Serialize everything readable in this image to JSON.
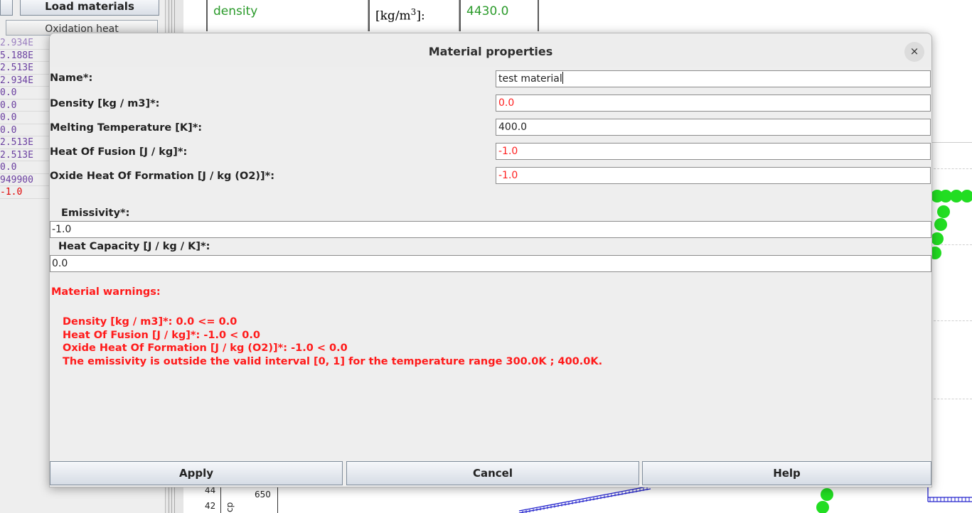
{
  "background": {
    "load_materials_label": "Load materials",
    "column_header": "Oxidation heat",
    "values": [
      {
        "text": "2.934E",
        "color": "#9b7fc0"
      },
      {
        "text": "5.188E",
        "color": "#6a3fa0"
      },
      {
        "text": "2.513E",
        "color": "#6a3fa0"
      },
      {
        "text": "2.934E",
        "color": "#6a3fa0"
      },
      {
        "text": "0.0",
        "color": "#6a3fa0"
      },
      {
        "text": "0.0",
        "color": "#6a3fa0"
      },
      {
        "text": "0.0",
        "color": "#6a3fa0"
      },
      {
        "text": "0.0",
        "color": "#6a3fa0"
      },
      {
        "text": "2.513E",
        "color": "#6a3fa0"
      },
      {
        "text": "2.513E",
        "color": "#6a3fa0"
      },
      {
        "text": "0.0",
        "color": "#6a3fa0"
      },
      {
        "text": "949900",
        "color": "#6a3fa0"
      },
      {
        "text": "-1.0",
        "color": "#e00000"
      }
    ],
    "top_table": {
      "property": "density",
      "unit_base": "[kg/m",
      "unit_sup": "3",
      "unit_end": "]:",
      "value": "4430.0"
    },
    "chart": {
      "tick_44": "44",
      "tick_42": "42",
      "tick_650": "650",
      "axis_label": "cp"
    }
  },
  "dialog": {
    "title": "Material properties",
    "close_symbol": "×",
    "fields": [
      {
        "label": "Name*:",
        "value": "test material",
        "invalid": false
      },
      {
        "label": "Density [kg / m3]*:",
        "value": "0.0",
        "invalid": true
      },
      {
        "label": "Melting Temperature [K]*:",
        "value": "400.0",
        "invalid": false
      },
      {
        "label": "Heat Of Fusion [J / kg]*:",
        "value": "-1.0",
        "invalid": true
      },
      {
        "label": "Oxide Heat Of Formation [J / kg (O2)]*:",
        "value": "-1.0",
        "invalid": true
      }
    ],
    "emissivity": {
      "label": "Emissivity*:",
      "value": "-1.0"
    },
    "heat_capacity": {
      "label": "Heat Capacity [J / kg / K]*:",
      "value": "0.0"
    },
    "warnings_title": "Material warnings:",
    "warnings": [
      "Density [kg / m3]*: 0.0 <= 0.0",
      "Heat Of Fusion [J / kg]*: -1.0 < 0.0",
      "Oxide Heat Of Formation [J / kg (O2)]*: -1.0 < 0.0",
      "The emissivity is outside the valid interval [0, 1] for the temperature range 300.0K ; 400.0K."
    ],
    "buttons": {
      "apply": "Apply",
      "cancel": "Cancel",
      "help": "Help"
    }
  },
  "colors": {
    "invalid_text": "#ff2020",
    "warning_text": "#ff1a1a",
    "green_series": "#22dd22",
    "blue_series": "#2222cc",
    "density_text": "#2a9a2a"
  }
}
